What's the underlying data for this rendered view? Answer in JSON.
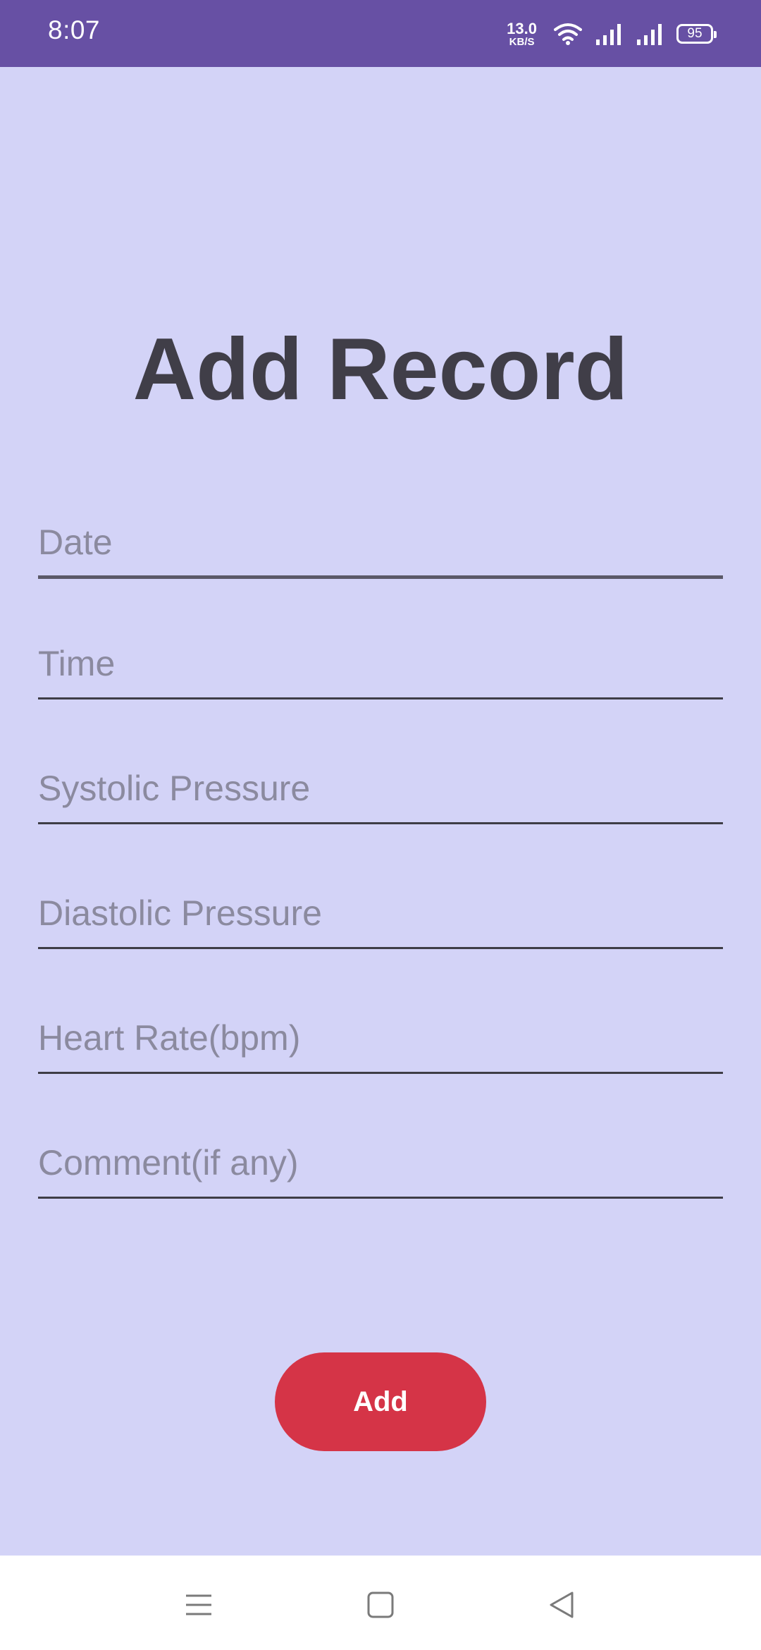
{
  "status_bar": {
    "time": "8:07",
    "net_speed_value": "13.0",
    "net_speed_unit": "KB/S",
    "battery_level": "95"
  },
  "page": {
    "title": "Add Record"
  },
  "form": {
    "fields": [
      {
        "placeholder": "Date",
        "value": ""
      },
      {
        "placeholder": "Time",
        "value": ""
      },
      {
        "placeholder": "Systolic Pressure",
        "value": ""
      },
      {
        "placeholder": "Diastolic Pressure",
        "value": ""
      },
      {
        "placeholder": "Heart Rate(bpm)",
        "value": ""
      },
      {
        "placeholder": "Comment(if any)",
        "value": ""
      }
    ],
    "submit_label": "Add"
  },
  "nav_bar": {
    "icons": [
      "menu-icon",
      "home-square-icon",
      "back-triangle-icon"
    ]
  },
  "colors": {
    "status_bar": "#6750a4",
    "background": "#d3d3f7",
    "title": "#403e48",
    "accent_button": "#d53447",
    "nav_background": "#ffffff"
  }
}
